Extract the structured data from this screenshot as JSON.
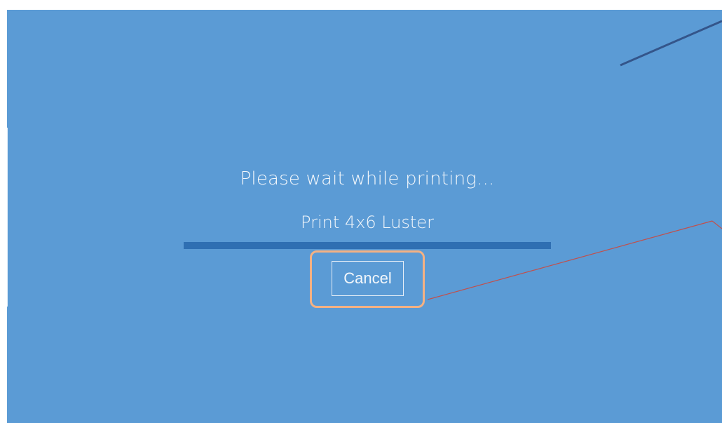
{
  "dialog": {
    "status_text": "Please wait while printing...",
    "job_name": "Print 4x6 Luster",
    "progress": 1.0,
    "cancel_label": "Cancel"
  },
  "colors": {
    "background": "#5b9bd5",
    "progress_fill": "#2f6fb2",
    "text": "#f3f7fb",
    "highlight": "#f4b183",
    "annotation_line_red": "#c0504d",
    "annotation_line_dark": "#34558a"
  }
}
